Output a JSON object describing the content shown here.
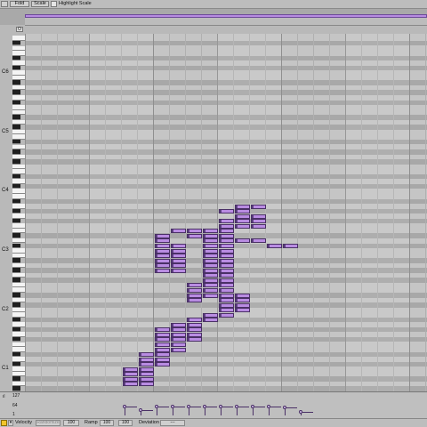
{
  "toolbar": {
    "fold_label": "Fold",
    "scale_label": "Scale",
    "highlight_scale_label": "Highlight Scale"
  },
  "keyboard": {
    "octaves": [
      "C6",
      "C5",
      "C4",
      "C3",
      "C2",
      "C1"
    ],
    "fold_button": "O"
  },
  "velocity": {
    "ticks": [
      "127",
      "64",
      "1"
    ],
    "values": [
      64,
      40,
      64,
      64,
      64,
      64,
      62,
      64,
      66,
      66,
      57,
      34
    ]
  },
  "bottom_bar": {
    "velocity_label": "Velocity",
    "randomize_label": "Randomize",
    "velocity_value": "100",
    "ramp_label": "Ramp",
    "ramp_start": "100",
    "ramp_end": "100",
    "deviation_label": "Deviation",
    "deviation_value": "---"
  },
  "colors": {
    "note_fill": "#b98ce2",
    "note_border": "#4a3066",
    "accent": "#b78be0",
    "grid_bg": "#c5c5c5"
  },
  "notes": [
    [
      0,
      1
    ],
    [
      1,
      1
    ],
    [
      0,
      2
    ],
    [
      1,
      2
    ],
    [
      0,
      3
    ],
    [
      1,
      3
    ],
    [
      0,
      4
    ],
    [
      1,
      4
    ],
    [
      1,
      5
    ],
    [
      2,
      5
    ],
    [
      1,
      6
    ],
    [
      2,
      6
    ],
    [
      1,
      7
    ],
    [
      2,
      7
    ],
    [
      2,
      8
    ],
    [
      2,
      9
    ],
    [
      3,
      8
    ],
    [
      3,
      9
    ],
    [
      2,
      10
    ],
    [
      3,
      10
    ],
    [
      4,
      10
    ],
    [
      2,
      11
    ],
    [
      3,
      11
    ],
    [
      4,
      11
    ],
    [
      2,
      12
    ],
    [
      3,
      12
    ],
    [
      4,
      12
    ],
    [
      3,
      13
    ],
    [
      4,
      13
    ],
    [
      4,
      14
    ],
    [
      5,
      14
    ],
    [
      5,
      15
    ],
    [
      6,
      15
    ],
    [
      6,
      16
    ],
    [
      7,
      16
    ],
    [
      6,
      17
    ],
    [
      7,
      17
    ],
    [
      4,
      18
    ],
    [
      6,
      18
    ],
    [
      7,
      18
    ],
    [
      4,
      19
    ],
    [
      5,
      19
    ],
    [
      6,
      19
    ],
    [
      7,
      19
    ],
    [
      4,
      20
    ],
    [
      5,
      20
    ],
    [
      6,
      20
    ],
    [
      4,
      21
    ],
    [
      5,
      21
    ],
    [
      6,
      21
    ],
    [
      5,
      22
    ],
    [
      6,
      22
    ],
    [
      5,
      23
    ],
    [
      6,
      23
    ],
    [
      2,
      24
    ],
    [
      3,
      24
    ],
    [
      5,
      24
    ],
    [
      6,
      24
    ],
    [
      2,
      25
    ],
    [
      3,
      25
    ],
    [
      5,
      25
    ],
    [
      6,
      25
    ],
    [
      2,
      26
    ],
    [
      3,
      26
    ],
    [
      5,
      26
    ],
    [
      6,
      26
    ],
    [
      2,
      27
    ],
    [
      3,
      27
    ],
    [
      5,
      27
    ],
    [
      6,
      27
    ],
    [
      2,
      28
    ],
    [
      3,
      28
    ],
    [
      5,
      28
    ],
    [
      6,
      28
    ],
    [
      2,
      29
    ],
    [
      3,
      29
    ],
    [
      5,
      29
    ],
    [
      6,
      29
    ],
    [
      9,
      29
    ],
    [
      10,
      29
    ],
    [
      2,
      30
    ],
    [
      5,
      30
    ],
    [
      6,
      30
    ],
    [
      7,
      30
    ],
    [
      8,
      30
    ],
    [
      2,
      31
    ],
    [
      4,
      31
    ],
    [
      5,
      31
    ],
    [
      6,
      31
    ],
    [
      3,
      32
    ],
    [
      4,
      32
    ],
    [
      5,
      32
    ],
    [
      6,
      32
    ],
    [
      6,
      33
    ],
    [
      7,
      33
    ],
    [
      8,
      33
    ],
    [
      6,
      34
    ],
    [
      7,
      34
    ],
    [
      8,
      34
    ],
    [
      7,
      35
    ],
    [
      8,
      35
    ],
    [
      6,
      36
    ],
    [
      7,
      36
    ],
    [
      7,
      37
    ],
    [
      8,
      37
    ]
  ]
}
